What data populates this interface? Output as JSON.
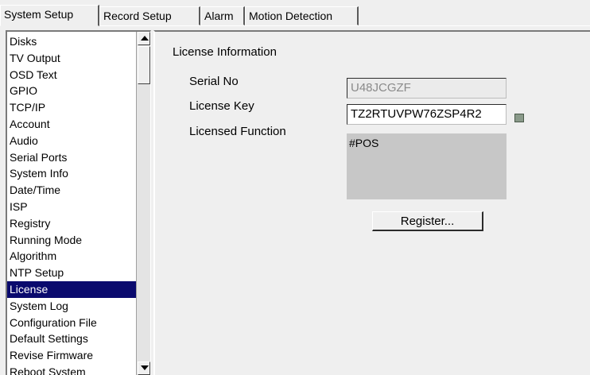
{
  "tabs": [
    {
      "label": "System Setup",
      "active": true
    },
    {
      "label": "Record Setup",
      "active": false
    },
    {
      "label": "Alarm",
      "active": false
    },
    {
      "label": "Motion Detection",
      "active": false
    }
  ],
  "sidebar": {
    "selected": "License",
    "items": [
      "Disks",
      "TV Output",
      "OSD Text",
      "GPIO",
      "TCP/IP",
      "Account",
      "Audio",
      "Serial Ports",
      "System Info",
      "Date/Time",
      "ISP",
      "Registry",
      "Running Mode",
      "Algorithm",
      "NTP Setup",
      "License",
      "System Log",
      "Configuration File",
      "Default Settings",
      "Revise Firmware",
      "Reboot System"
    ]
  },
  "license": {
    "section_title": "License Information",
    "serial_label": "Serial No",
    "serial_value": "U48JCGZF",
    "key_label": "License Key",
    "key_value": "TZ2RTUVPW76ZSP4R2",
    "function_label": "Licensed Function",
    "function_value": "#POS",
    "register_button": "Register..."
  },
  "icons": {
    "keyboard": "keyboard-icon",
    "scroll_up": "scroll-up-arrow-icon",
    "scroll_down": "scroll-down-arrow-icon"
  },
  "colors": {
    "selection": "#0a0a6e",
    "background": "#efefef",
    "function_box": "#c7c7c7"
  }
}
